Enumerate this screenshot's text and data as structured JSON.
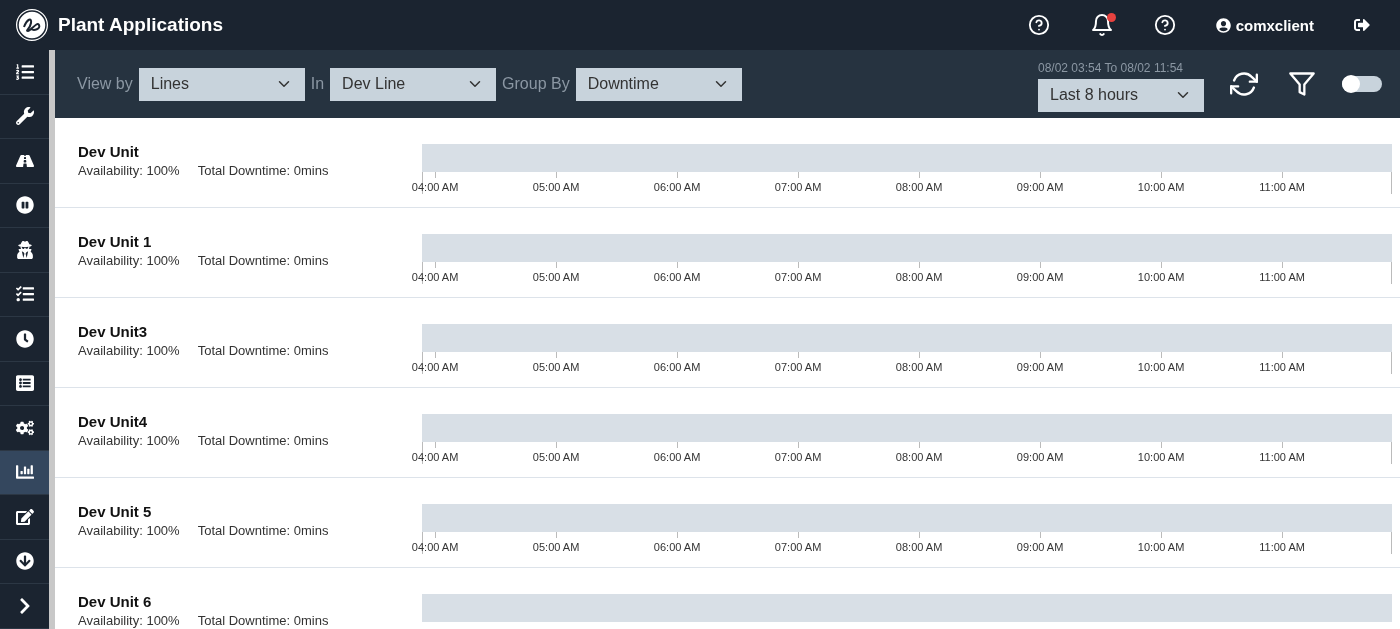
{
  "header": {
    "title": "Plant Applications",
    "user": "comxclient",
    "notification_badge": true
  },
  "sidebar": {
    "items": [
      {
        "selected": false
      },
      {
        "selected": false
      },
      {
        "selected": false
      },
      {
        "selected": false
      },
      {
        "selected": false
      },
      {
        "selected": false
      },
      {
        "selected": false
      },
      {
        "selected": false
      },
      {
        "selected": false
      },
      {
        "selected": true
      },
      {
        "selected": false
      },
      {
        "selected": false
      }
    ]
  },
  "toolbar": {
    "filters": [
      {
        "label": "View by",
        "value": "Lines"
      },
      {
        "label": "In",
        "value": "Dev Line"
      },
      {
        "label": "Group By",
        "value": "Downtime"
      }
    ],
    "range_text": "08/02 03:54 To 08/02 11:54",
    "range": "Last 8 hours",
    "toggle_on": false
  },
  "rows": [
    {
      "name": "Dev Unit",
      "availability": "Availability: 100%",
      "downtime": "Total Downtime: 0mins",
      "ticks": [
        "04:00 AM",
        "05:00 AM",
        "06:00 AM",
        "07:00 AM",
        "08:00 AM",
        "09:00 AM",
        "10:00 AM",
        "11:00 AM"
      ]
    },
    {
      "name": "Dev Unit 1",
      "availability": "Availability: 100%",
      "downtime": "Total Downtime: 0mins",
      "ticks": [
        "04:00 AM",
        "05:00 AM",
        "06:00 AM",
        "07:00 AM",
        "08:00 AM",
        "09:00 AM",
        "10:00 AM",
        "11:00 AM"
      ]
    },
    {
      "name": "Dev Unit3",
      "availability": "Availability: 100%",
      "downtime": "Total Downtime: 0mins",
      "ticks": [
        "04:00 AM",
        "05:00 AM",
        "06:00 AM",
        "07:00 AM",
        "08:00 AM",
        "09:00 AM",
        "10:00 AM",
        "11:00 AM"
      ]
    },
    {
      "name": "Dev Unit4",
      "availability": "Availability: 100%",
      "downtime": "Total Downtime: 0mins",
      "ticks": [
        "04:00 AM",
        "05:00 AM",
        "06:00 AM",
        "07:00 AM",
        "08:00 AM",
        "09:00 AM",
        "10:00 AM",
        "11:00 AM"
      ]
    },
    {
      "name": "Dev Unit 5",
      "availability": "Availability: 100%",
      "downtime": "Total Downtime: 0mins",
      "ticks": [
        "04:00 AM",
        "05:00 AM",
        "06:00 AM",
        "07:00 AM",
        "08:00 AM",
        "09:00 AM",
        "10:00 AM",
        "11:00 AM"
      ]
    },
    {
      "name": "Dev Unit 6",
      "availability": "Availability: 100%",
      "downtime": "Total Downtime: 0mins",
      "ticks": []
    }
  ]
}
